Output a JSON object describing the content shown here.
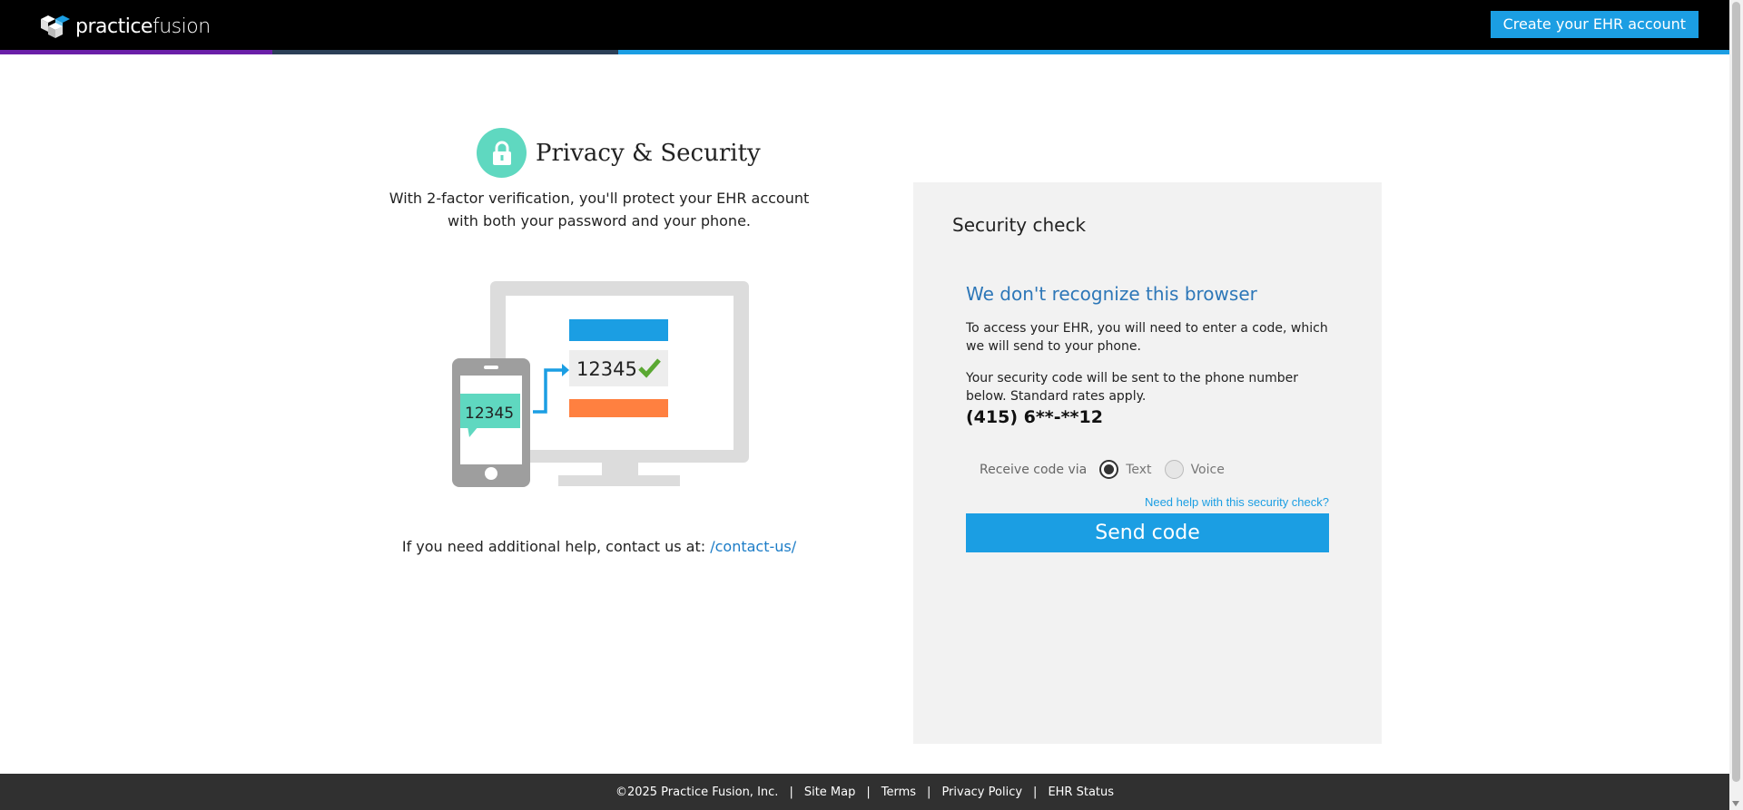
{
  "header": {
    "logo_part1": "practice",
    "logo_part2": "fusion",
    "create_button": "Create your EHR account",
    "stripe_colors": [
      "#6a1fa8",
      "#2b3f57",
      "#1b9ee3"
    ]
  },
  "privacy": {
    "title": "Privacy & Security",
    "description": "With 2-factor verification, you'll protect your EHR account with both your password and your phone.",
    "illustration_phone_code": "12345",
    "illustration_screen_code": "12345",
    "help_text": "If you need additional help, contact us at:",
    "help_link": "/contact-us/"
  },
  "security_check": {
    "title": "Security check",
    "subtitle": "We don't recognize this browser",
    "paragraph1": "To access your EHR, you will need to enter a code, which we will send to your phone.",
    "paragraph2": "Your security code will be sent to the phone number below. Standard rates apply.",
    "phone_number": "(415) 6**-**12",
    "receive_label": "Receive code via",
    "options": [
      {
        "label": "Text",
        "selected": true
      },
      {
        "label": "Voice",
        "selected": false
      }
    ],
    "help_link": "Need help with this security check?",
    "send_button": "Send code"
  },
  "footer": {
    "copyright": "©2025 Practice Fusion, Inc.",
    "links": [
      "Site Map",
      "Terms",
      "Privacy Policy",
      "EHR Status"
    ]
  },
  "colors": {
    "accent": "#1b9ee3",
    "teal": "#5fd8c0",
    "orange": "#ff8040",
    "check_green": "#5aa832"
  }
}
